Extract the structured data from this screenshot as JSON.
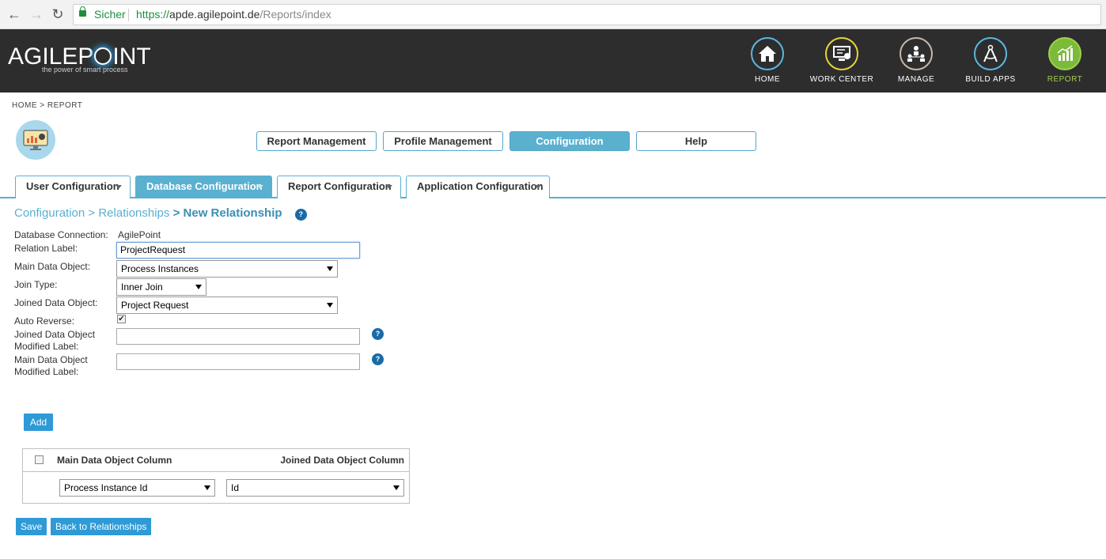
{
  "browser": {
    "secure_label": "Sicher",
    "url_scheme": "https://",
    "url_host": "apde.agilepoint.de",
    "url_path": "/Reports/index"
  },
  "header": {
    "logo_left": "AGILEP",
    "logo_right": "INT",
    "tagline": "the power of smart process",
    "nav": [
      {
        "label": "HOME",
        "icon": "home-icon",
        "ring": "#5bb7e0"
      },
      {
        "label": "WORK CENTER",
        "icon": "workcenter-icon",
        "ring": "#e8d43a"
      },
      {
        "label": "MANAGE",
        "icon": "manage-icon",
        "ring": "#c8b8a8"
      },
      {
        "label": "BUILD APPS",
        "icon": "build-apps-icon",
        "ring": "#5bb7e0"
      },
      {
        "label": "REPORT",
        "icon": "report-icon",
        "ring": "#9ed14a"
      }
    ],
    "active_color": "#9ed14a"
  },
  "breadcrumb": "HOME > REPORT",
  "top_buttons": [
    "Report Management",
    "Profile Management",
    "Configuration",
    "Help"
  ],
  "tabs": [
    "User Configuration",
    "Database Configuration",
    "Report Configuration",
    "Application Configuration"
  ],
  "page_path": {
    "part1": "Configuration",
    "sep": ">",
    "part2": "Relationships",
    "current": "New Relationship"
  },
  "help_glyph": "?",
  "form": {
    "db_connection_label": "Database Connection:",
    "db_connection_value": "AgilePoint",
    "relation_label_label": "Relation Label:",
    "relation_label_value": "ProjectRequest",
    "main_object_label": "Main Data Object:",
    "main_object_value": "Process Instances",
    "join_type_label": "Join Type:",
    "join_type_value": "Inner Join",
    "joined_object_label": "Joined Data Object:",
    "joined_object_value": "Project Request",
    "auto_reverse_label": "Auto Reverse:",
    "joined_modified_label_1": "Joined Data Object",
    "joined_modified_label_2": "Modified Label:",
    "main_modified_label_1": "Main Data Object",
    "main_modified_label_2": "Modified Label:"
  },
  "add_button": "Add",
  "table": {
    "col1": "Main Data Object Column",
    "col2": "Joined Data Object Column",
    "row_main_value": "Process Instance Id",
    "row_joined_value": "Id"
  },
  "save_button": "Save",
  "back_button": "Back to Relationships",
  "colors": {
    "accent": "#5ab0cf",
    "button_blue": "#2e9ad6",
    "header_bg": "#2d2d2d"
  }
}
